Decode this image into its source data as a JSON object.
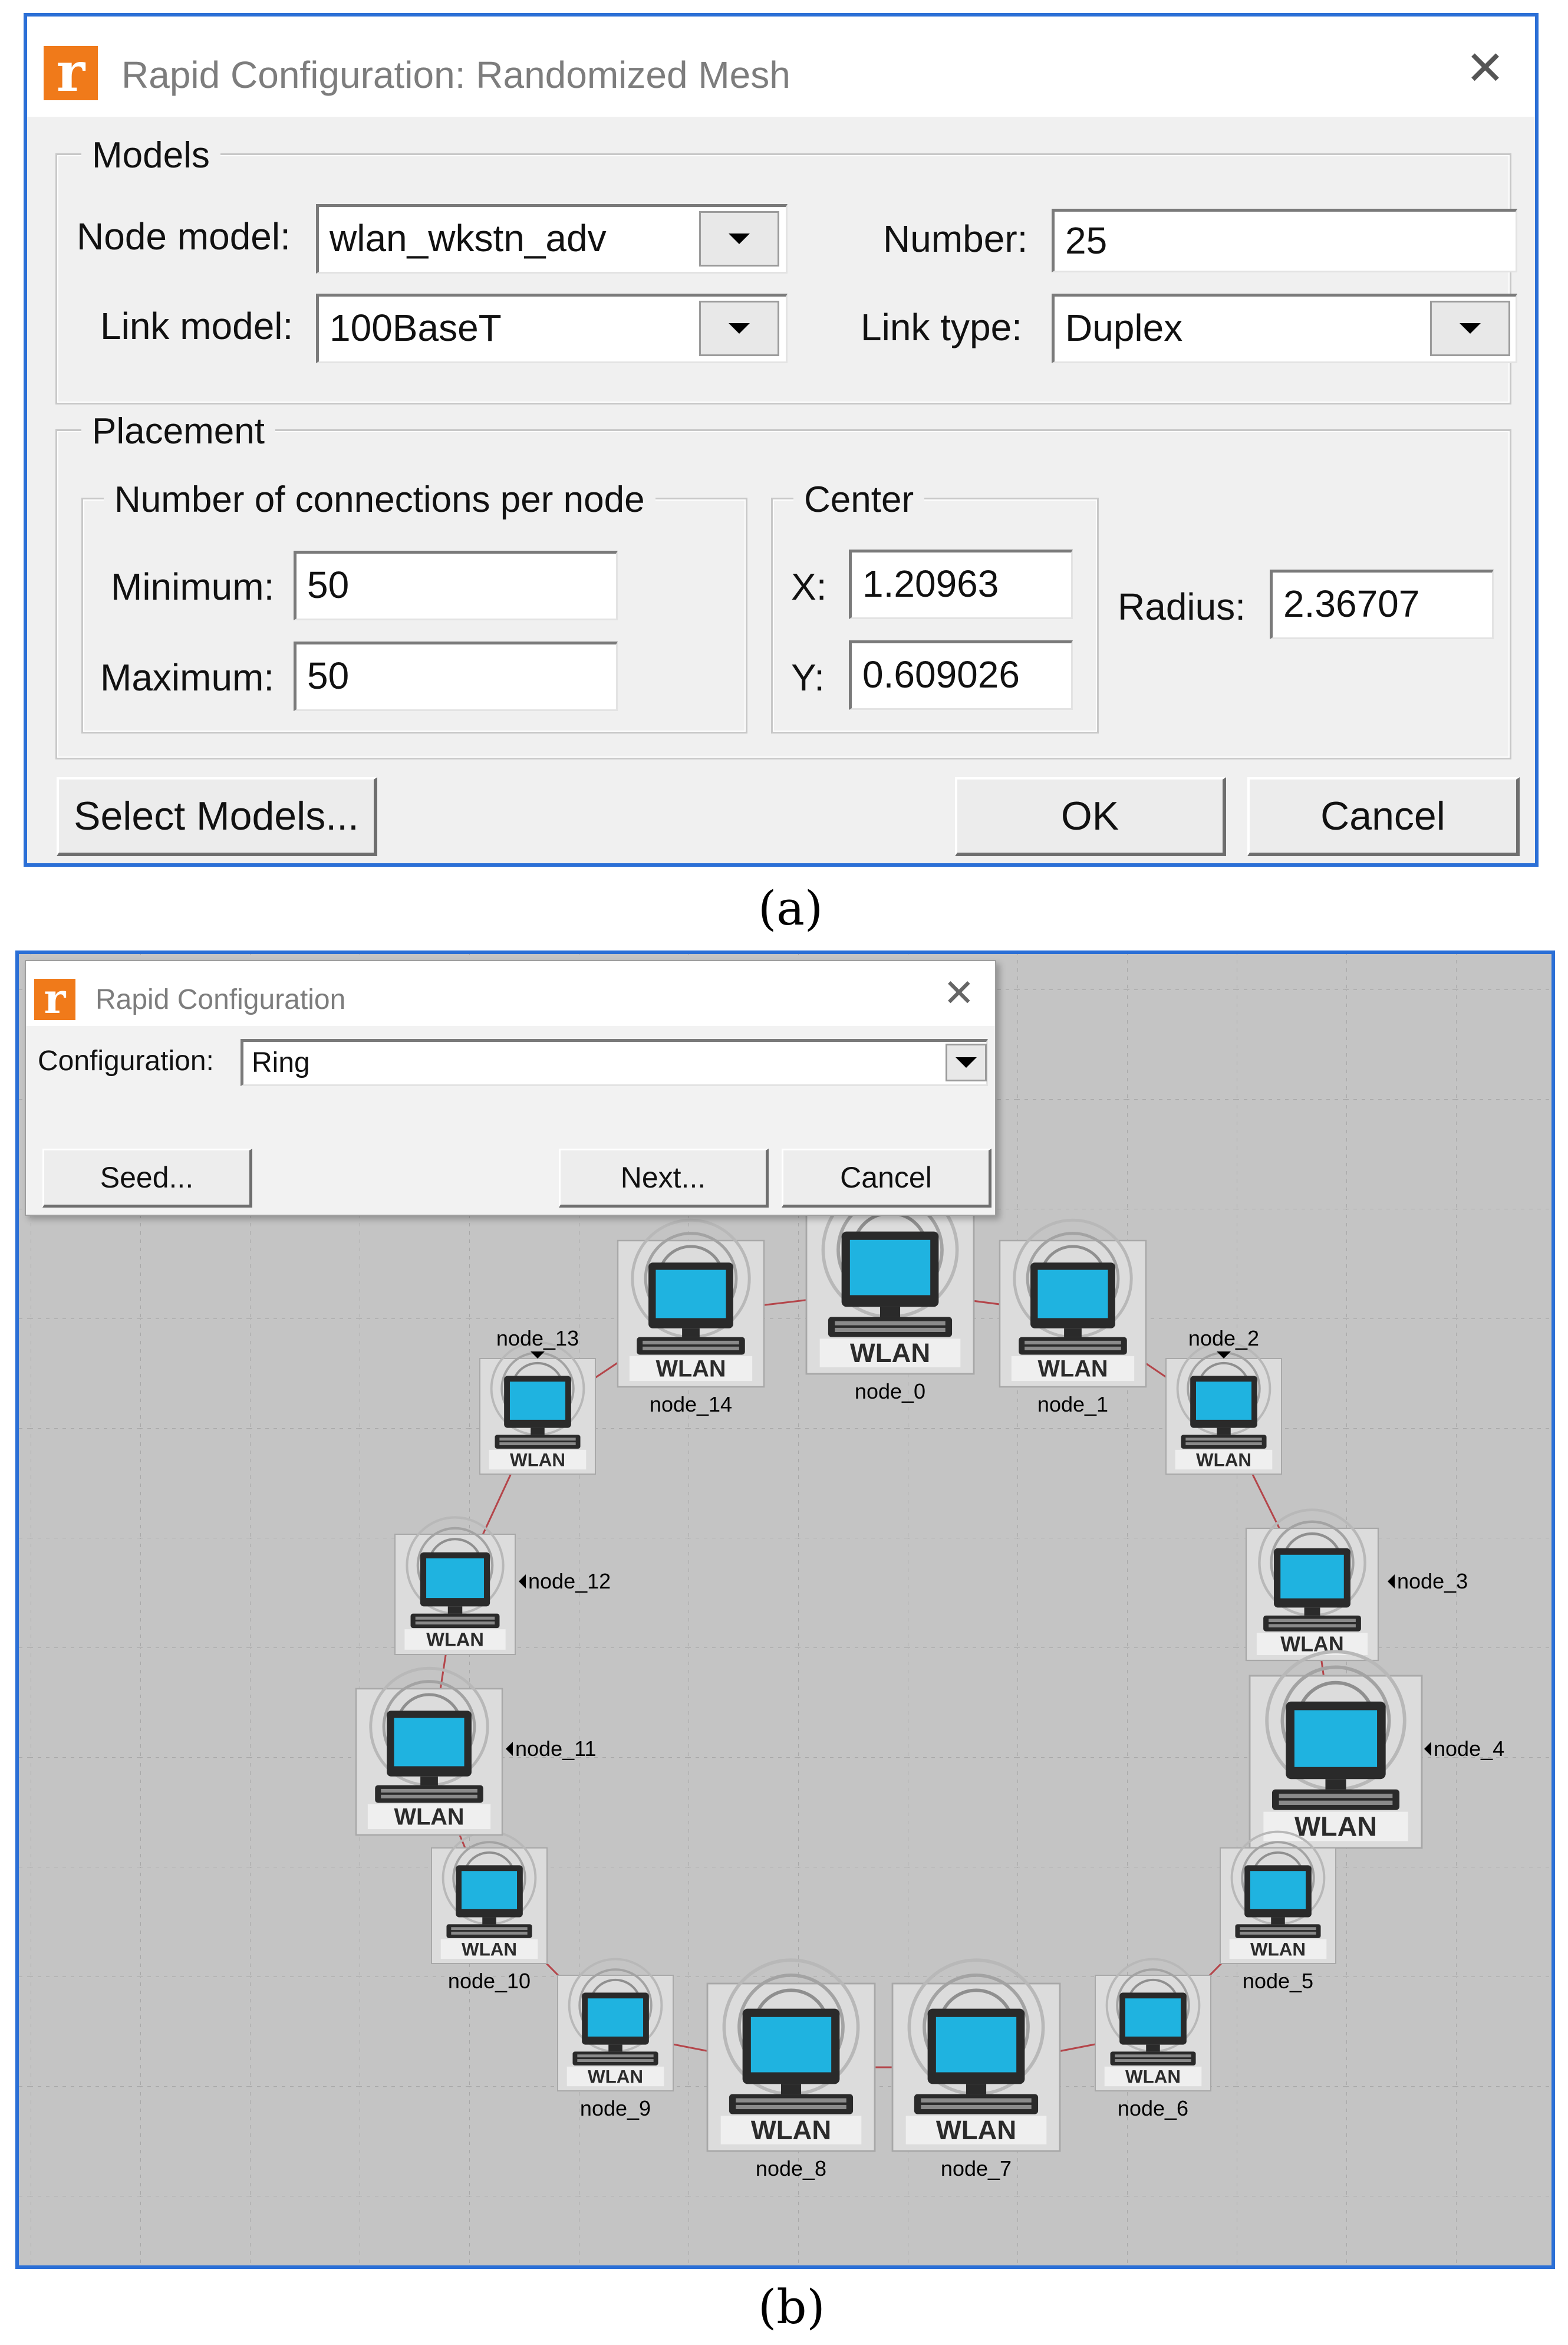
{
  "dialog_a": {
    "title": "Rapid Configuration: Randomized Mesh",
    "app_icon": "r",
    "close_icon": "✕",
    "models": {
      "group_label": "Models",
      "node_model_label": "Node model:",
      "node_model_value": "wlan_wkstn_adv",
      "link_model_label": "Link model:",
      "link_model_value": "100BaseT",
      "number_label": "Number:",
      "number_value": "25",
      "link_type_label": "Link type:",
      "link_type_value": "Duplex"
    },
    "placement": {
      "group_label": "Placement",
      "connections_group_label": "Number of connections per node",
      "minimum_label": "Minimum:",
      "minimum_value": "50",
      "maximum_label": "Maximum:",
      "maximum_value": "50",
      "center_group_label": "Center",
      "x_label": "X:",
      "x_value": "1.20963",
      "y_label": "Y:",
      "y_value": "0.609026",
      "radius_label": "Radius:",
      "radius_value": "2.36707"
    },
    "buttons": {
      "select_models": "Select Models...",
      "ok": "OK",
      "cancel": "Cancel"
    },
    "caption": "(a)"
  },
  "dialog_b": {
    "title": "Rapid Configuration",
    "app_icon": "r",
    "close_icon": "✕",
    "configuration_label": "Configuration:",
    "configuration_value": "Ring",
    "buttons": {
      "seed": "Seed...",
      "next": "Next...",
      "cancel": "Cancel"
    },
    "caption": "(b)"
  },
  "network": {
    "badge_text": "WLAN",
    "node_icon": "wlan-workstation-icon",
    "colors": {
      "screen": "#1fb3e0",
      "link": "#b4454a",
      "canvas": "#c4c4c4"
    },
    "nodes": [
      "node_0",
      "node_1",
      "node_2",
      "node_3",
      "node_4",
      "node_5",
      "node_6",
      "node_7",
      "node_8",
      "node_9",
      "node_10",
      "node_11",
      "node_12",
      "node_13",
      "node_14"
    ]
  }
}
